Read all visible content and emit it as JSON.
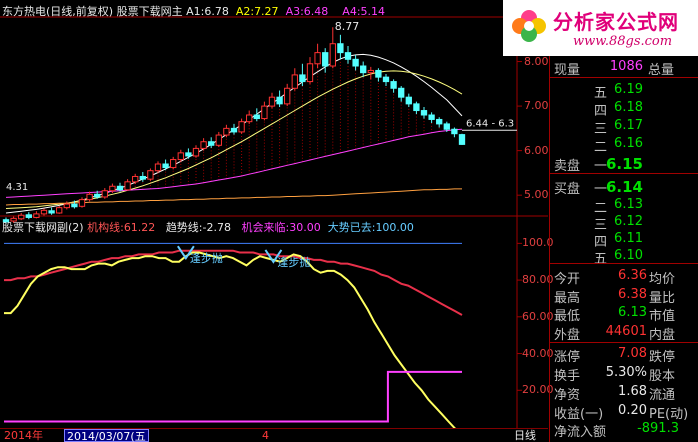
{
  "main_title": {
    "stock": "东方热电(日线,前复权)",
    "indicator": "股票下载网主",
    "a1_label": "A1:",
    "a1_value": "6.78",
    "a2_label": "A2:",
    "a2_value": "7.27",
    "a3_label": "A3:",
    "a3_value": "6.48",
    "a4_label": "A4:",
    "a4_value": "5.14"
  },
  "sub_title": {
    "indicator": "股票下载网副(2)",
    "l1_label": "机构线:",
    "l1_value": "61.22",
    "l2_label": "趋势线:",
    "l2_value": "-2.78",
    "l3_label": "机会来临:",
    "l3_value": "30.00",
    "l4_label": "大势已去:",
    "l4_value": "100.00"
  },
  "chart_annotations": {
    "high": "8.77",
    "low": "4.31",
    "last_price_tag": "6.44 - 6.3",
    "sell_signal_1": "逢步抛",
    "sell_signal_2": "逢步抛"
  },
  "main_axis_labels": [
    "8.00",
    "7.00",
    "6.00",
    "5.00"
  ],
  "sub_axis_labels": [
    "100.0",
    "80.00",
    "60.00",
    "40.00",
    "20.00"
  ],
  "bottom_bar": {
    "year": "2014年",
    "date": "2014/03/07(五",
    "month": "4",
    "period": "日线"
  },
  "logo": {
    "brand": "分析家公式网",
    "url": "www.88gs.com"
  },
  "quote": {
    "current_volume_label": "现量",
    "current_volume": "1086",
    "total_volume_label": "总量",
    "asks": [
      {
        "label": "五",
        "price": "6.19"
      },
      {
        "label": "四",
        "price": "6.18"
      },
      {
        "label": "三",
        "price": "6.17"
      },
      {
        "label": "二",
        "price": "6.16"
      }
    ],
    "sell_label": "卖盘",
    "ask1_label": "一",
    "ask1_price": "6.15",
    "buy_label": "买盘",
    "bid1_label": "一",
    "bid1_price": "6.14",
    "bids": [
      {
        "label": "二",
        "price": "6.13"
      },
      {
        "label": "三",
        "price": "6.12"
      },
      {
        "label": "四",
        "price": "6.11"
      },
      {
        "label": "五",
        "price": "6.10"
      }
    ],
    "stats": [
      {
        "label": "今开",
        "value": "6.36",
        "label2": "均价",
        "color": "red"
      },
      {
        "label": "最高",
        "value": "6.38",
        "label2": "量比",
        "color": "red"
      },
      {
        "label": "最低",
        "value": "6.13",
        "label2": "市值",
        "color": "grn"
      },
      {
        "label": "外盘",
        "value": "44601",
        "label2": "内盘",
        "color": "red"
      }
    ],
    "stats2": [
      {
        "label": "涨停",
        "value": "7.08",
        "label2": "跌停",
        "color": "red"
      },
      {
        "label": "换手",
        "value": "5.30%",
        "label2": "股本",
        "color": "wht"
      },
      {
        "label": "净资",
        "value": "1.68",
        "label2": "流通",
        "color": "wht"
      },
      {
        "label": "收益(一)",
        "value": "0.20",
        "label2": "PE(动)",
        "color": "wht"
      }
    ],
    "net_inflow_label": "净流入额",
    "net_inflow": "-891.3"
  },
  "chart_data": [
    {
      "type": "candlestick",
      "title": "股票下载网主",
      "ylim": [
        4.6,
        9.0
      ],
      "y_ticks": [
        5.0,
        6.0,
        7.0,
        8.0
      ],
      "candles": [
        [
          4.45,
          4.4,
          4.5,
          4.35
        ],
        [
          4.42,
          4.48,
          4.52,
          4.38
        ],
        [
          4.47,
          4.55,
          4.6,
          4.44
        ],
        [
          4.56,
          4.5,
          4.62,
          4.46
        ],
        [
          4.5,
          4.58,
          4.64,
          4.48
        ],
        [
          4.58,
          4.66,
          4.7,
          4.54
        ],
        [
          4.65,
          4.6,
          4.72,
          4.56
        ],
        [
          4.6,
          4.72,
          4.76,
          4.58
        ],
        [
          4.72,
          4.8,
          4.86,
          4.68
        ],
        [
          4.8,
          4.74,
          4.88,
          4.7
        ],
        [
          4.75,
          4.9,
          4.95,
          4.72
        ],
        [
          4.9,
          5.02,
          5.08,
          4.86
        ],
        [
          5.02,
          4.96,
          5.1,
          4.92
        ],
        [
          4.96,
          5.1,
          5.16,
          4.92
        ],
        [
          5.1,
          5.2,
          5.26,
          5.05
        ],
        [
          5.2,
          5.12,
          5.28,
          5.08
        ],
        [
          5.12,
          5.3,
          5.36,
          5.1
        ],
        [
          5.3,
          5.42,
          5.48,
          5.25
        ],
        [
          5.42,
          5.36,
          5.52,
          5.3
        ],
        [
          5.36,
          5.55,
          5.6,
          5.32
        ],
        [
          5.55,
          5.7,
          5.76,
          5.5
        ],
        [
          5.7,
          5.62,
          5.8,
          5.56
        ],
        [
          5.62,
          5.8,
          5.86,
          5.58
        ],
        [
          5.8,
          5.95,
          6.02,
          5.74
        ],
        [
          5.95,
          5.88,
          6.05,
          5.82
        ],
        [
          5.88,
          6.05,
          6.12,
          5.84
        ],
        [
          6.05,
          6.2,
          6.28,
          6.0
        ],
        [
          6.2,
          6.12,
          6.3,
          6.06
        ],
        [
          6.12,
          6.35,
          6.42,
          6.08
        ],
        [
          6.35,
          6.5,
          6.58,
          6.3
        ],
        [
          6.5,
          6.42,
          6.6,
          6.36
        ],
        [
          6.42,
          6.65,
          6.72,
          6.38
        ],
        [
          6.65,
          6.8,
          6.9,
          6.6
        ],
        [
          6.8,
          6.72,
          6.95,
          6.66
        ],
        [
          6.72,
          7.0,
          7.1,
          6.68
        ],
        [
          7.0,
          7.2,
          7.3,
          6.95
        ],
        [
          7.2,
          7.05,
          7.35,
          6.98
        ],
        [
          7.05,
          7.4,
          7.5,
          7.0
        ],
        [
          7.4,
          7.7,
          7.85,
          7.35
        ],
        [
          7.7,
          7.55,
          7.95,
          7.45
        ],
        [
          7.55,
          7.95,
          8.1,
          7.5
        ],
        [
          7.95,
          8.2,
          8.4,
          7.85
        ],
        [
          8.2,
          7.9,
          8.3,
          7.75
        ],
        [
          7.9,
          8.4,
          8.77,
          7.85
        ],
        [
          8.4,
          8.2,
          8.6,
          8.05
        ],
        [
          8.2,
          8.05,
          8.35,
          7.95
        ],
        [
          8.05,
          7.9,
          8.15,
          7.8
        ],
        [
          7.9,
          7.75,
          8.0,
          7.65
        ],
        [
          7.75,
          7.8,
          7.88,
          7.6
        ],
        [
          7.8,
          7.65,
          7.85,
          7.55
        ],
        [
          7.65,
          7.55,
          7.72,
          7.45
        ],
        [
          7.55,
          7.4,
          7.6,
          7.3
        ],
        [
          7.4,
          7.2,
          7.45,
          7.1
        ],
        [
          7.2,
          7.05,
          7.28,
          6.98
        ],
        [
          7.05,
          6.9,
          7.1,
          6.82
        ],
        [
          6.9,
          6.8,
          6.98,
          6.72
        ],
        [
          6.8,
          6.7,
          6.86,
          6.62
        ],
        [
          6.7,
          6.6,
          6.75,
          6.52
        ],
        [
          6.6,
          6.48,
          6.65,
          6.42
        ],
        [
          6.48,
          6.38,
          6.52,
          6.3
        ],
        [
          6.36,
          6.14,
          6.38,
          6.13
        ]
      ],
      "series": [
        {
          "name": "A1",
          "color": "#ffffff",
          "values": [
            4.6,
            4.62,
            4.64,
            4.66,
            4.68,
            4.71,
            4.74,
            4.77,
            4.81,
            4.85,
            4.89,
            4.94,
            4.99,
            5.04,
            5.1,
            5.16,
            5.22,
            5.29,
            5.36,
            5.43,
            5.51,
            5.59,
            5.67,
            5.76,
            5.85,
            5.94,
            6.04,
            6.14,
            6.25,
            6.36,
            6.47,
            6.58,
            6.7,
            6.82,
            6.94,
            7.06,
            7.18,
            7.3,
            7.42,
            7.54,
            7.66,
            7.77,
            7.88,
            7.98,
            8.06,
            8.12,
            8.15,
            8.16,
            8.14,
            8.1,
            8.04,
            7.97,
            7.88,
            7.78,
            7.67,
            7.55,
            7.42,
            7.28,
            7.14,
            6.96,
            6.78
          ]
        },
        {
          "name": "A2",
          "color": "#ffff80",
          "values": [
            4.7,
            4.71,
            4.72,
            4.73,
            4.74,
            4.76,
            4.78,
            4.8,
            4.82,
            4.85,
            4.88,
            4.91,
            4.94,
            4.98,
            5.02,
            5.06,
            5.11,
            5.16,
            5.21,
            5.27,
            5.33,
            5.39,
            5.46,
            5.53,
            5.6,
            5.68,
            5.76,
            5.84,
            5.93,
            6.02,
            6.11,
            6.2,
            6.3,
            6.4,
            6.5,
            6.6,
            6.7,
            6.8,
            6.9,
            7.0,
            7.1,
            7.2,
            7.29,
            7.38,
            7.46,
            7.54,
            7.61,
            7.67,
            7.72,
            7.76,
            7.78,
            7.79,
            7.78,
            7.76,
            7.72,
            7.67,
            7.61,
            7.54,
            7.46,
            7.37,
            7.27
          ]
        },
        {
          "name": "A3",
          "color": "#ff40ff",
          "values": [
            4.95,
            4.96,
            4.97,
            4.98,
            4.99,
            5.0,
            5.01,
            5.02,
            5.03,
            5.04,
            5.05,
            5.06,
            5.07,
            5.08,
            5.09,
            5.1,
            5.11,
            5.12,
            5.13,
            5.14,
            5.15,
            5.17,
            5.19,
            5.21,
            5.23,
            5.25,
            5.28,
            5.31,
            5.34,
            5.37,
            5.4,
            5.43,
            5.47,
            5.51,
            5.55,
            5.59,
            5.63,
            5.67,
            5.71,
            5.75,
            5.79,
            5.83,
            5.87,
            5.91,
            5.95,
            5.99,
            6.03,
            6.07,
            6.11,
            6.15,
            6.19,
            6.23,
            6.27,
            6.31,
            6.34,
            6.37,
            6.4,
            6.43,
            6.45,
            6.47,
            6.48
          ]
        },
        {
          "name": "A4",
          "color": "#ffa040",
          "values": [
            4.78,
            4.79,
            4.79,
            4.8,
            4.8,
            4.81,
            4.81,
            4.82,
            4.82,
            4.83,
            4.83,
            4.84,
            4.84,
            4.85,
            4.85,
            4.86,
            4.86,
            4.87,
            4.87,
            4.88,
            4.88,
            4.89,
            4.89,
            4.9,
            4.9,
            4.91,
            4.91,
            4.92,
            4.92,
            4.93,
            4.93,
            4.94,
            4.94,
            4.95,
            4.95,
            4.96,
            4.96,
            4.97,
            4.97,
            4.98,
            4.98,
            4.99,
            4.99,
            5.0,
            5.01,
            5.02,
            5.03,
            5.04,
            5.05,
            5.06,
            5.07,
            5.08,
            5.09,
            5.1,
            5.11,
            5.12,
            5.12,
            5.13,
            5.13,
            5.14,
            5.14
          ]
        }
      ]
    },
    {
      "type": "line",
      "title": "股票下载网副(2)",
      "ylim": [
        0,
        110
      ],
      "y_ticks": [
        20,
        40,
        60,
        80,
        100
      ],
      "series": [
        {
          "name": "机构线",
          "color": "#e8304a",
          "values": [
            80,
            80,
            81,
            81,
            82,
            82,
            83,
            84,
            85,
            86,
            87,
            88,
            89,
            90,
            90,
            91,
            92,
            92,
            93,
            93,
            94,
            94,
            94,
            95,
            95,
            95,
            96,
            96,
            96,
            96,
            96,
            96,
            96,
            96,
            96,
            95,
            95,
            95,
            94,
            94,
            94,
            93,
            93,
            93,
            92,
            92,
            91,
            91,
            90,
            90,
            89,
            89,
            88,
            87,
            86,
            85,
            83,
            82,
            80,
            78,
            77,
            75,
            73,
            71,
            69,
            67,
            65,
            63,
            61
          ]
        },
        {
          "name": "趋势线",
          "color": "#ffff60",
          "values": [
            62,
            62,
            66,
            72,
            78,
            82,
            84,
            86,
            87,
            87,
            86,
            86,
            86,
            88,
            89,
            89,
            88,
            90,
            91,
            92,
            92,
            93,
            93,
            92,
            92,
            90,
            90,
            93,
            95,
            95,
            94,
            93,
            92,
            93,
            92,
            90,
            88,
            91,
            93,
            92,
            91,
            90,
            92,
            94,
            93,
            90,
            86,
            84,
            85,
            85,
            83,
            80,
            76,
            70,
            64,
            57,
            51,
            45,
            39,
            34,
            29,
            24,
            20,
            15,
            11,
            7,
            3,
            -1,
            -3
          ]
        },
        {
          "name": "机会来临",
          "color": "#ff40ff",
          "values": [
            3,
            3,
            3,
            3,
            3,
            3,
            3,
            3,
            3,
            3,
            3,
            3,
            3,
            3,
            3,
            3,
            3,
            3,
            3,
            3,
            3,
            3,
            3,
            3,
            3,
            3,
            3,
            3,
            3,
            3,
            3,
            3,
            3,
            3,
            3,
            3,
            3,
            3,
            3,
            3,
            3,
            3,
            3,
            3,
            3,
            3,
            3,
            3,
            3,
            3,
            3,
            3,
            3,
            3,
            3,
            3,
            3,
            30,
            30,
            30,
            30,
            30,
            30,
            30,
            30,
            30,
            30,
            30,
            30
          ]
        },
        {
          "name": "大势已去",
          "color": "#4080ff",
          "values": [
            100,
            100,
            100,
            100,
            100,
            100,
            100,
            100,
            100,
            100,
            100,
            100,
            100,
            100,
            100,
            100,
            100,
            100,
            100,
            100,
            100,
            100,
            100,
            100,
            100,
            100,
            100,
            100,
            100,
            100,
            100,
            100,
            100,
            100,
            100,
            100,
            100,
            100,
            100,
            100,
            100,
            100,
            100,
            100,
            100,
            100,
            100,
            100,
            100,
            100,
            100,
            100,
            100,
            100,
            100,
            100,
            100,
            100,
            100,
            100,
            100,
            100,
            100,
            100,
            100,
            100,
            100,
            100,
            100
          ]
        }
      ]
    }
  ]
}
